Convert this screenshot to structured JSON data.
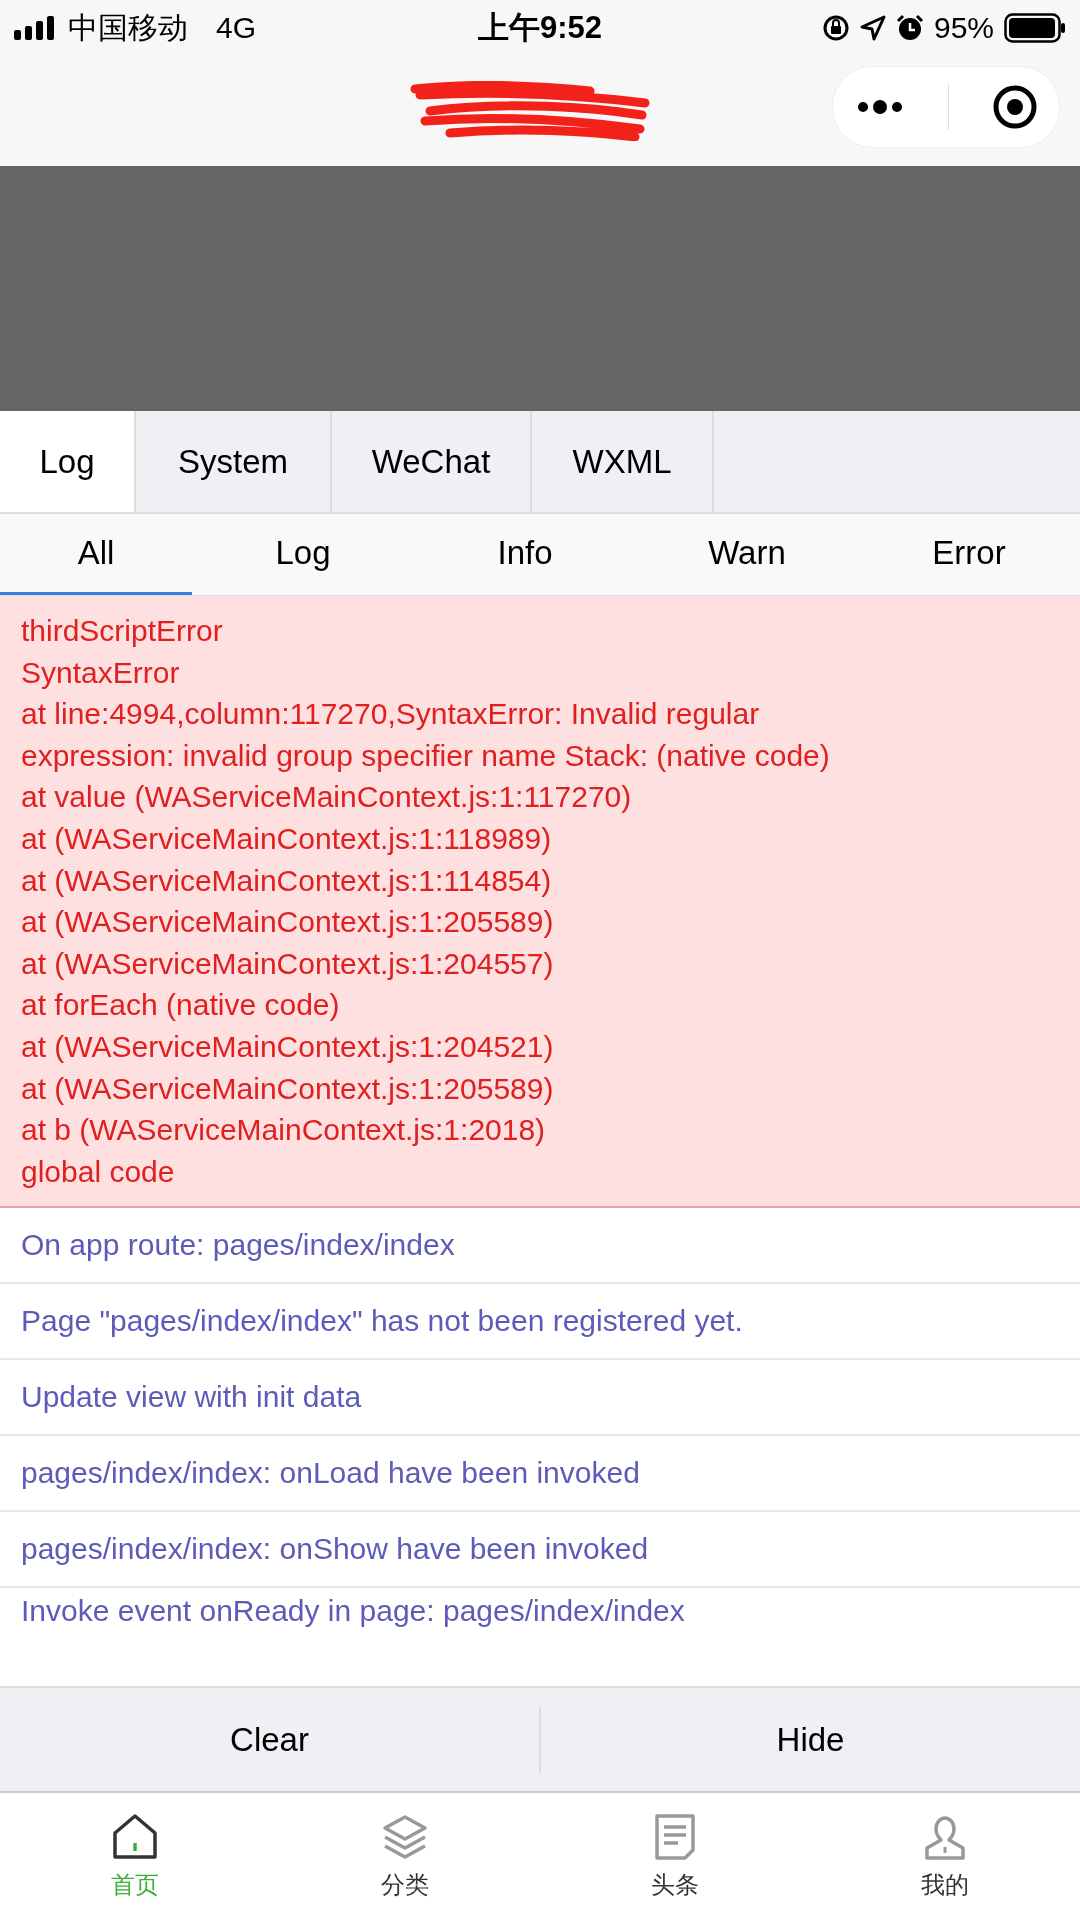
{
  "status_bar": {
    "carrier": "中国移动",
    "network": "4G",
    "time": "上午9:52",
    "battery": "95%"
  },
  "tabs": [
    {
      "label": "Log",
      "selected": true
    },
    {
      "label": "System",
      "selected": false
    },
    {
      "label": "WeChat",
      "selected": false
    },
    {
      "label": "WXML",
      "selected": false
    }
  ],
  "filters": [
    {
      "label": "All",
      "selected": true
    },
    {
      "label": "Log",
      "selected": false
    },
    {
      "label": "Info",
      "selected": false
    },
    {
      "label": "Warn",
      "selected": false
    },
    {
      "label": "Error",
      "selected": false
    }
  ],
  "entries": [
    {
      "kind": "error",
      "lines": [
        "thirdScriptError",
        "SyntaxError",
        "at line:4994,column:117270,SyntaxError: Invalid regular expression: invalid group specifier name Stack: (native code)",
        "at value (WAServiceMainContext.js:1:117270)",
        "at (WAServiceMainContext.js:1:118989)",
        "at (WAServiceMainContext.js:1:114854)",
        "at (WAServiceMainContext.js:1:205589)",
        "at (WAServiceMainContext.js:1:204557)",
        "at forEach (native code)",
        "at (WAServiceMainContext.js:1:204521)",
        "at (WAServiceMainContext.js:1:205589)",
        "at b (WAServiceMainContext.js:1:2018)",
        "global code"
      ]
    },
    {
      "kind": "log",
      "lines": [
        "On app route: pages/index/index"
      ]
    },
    {
      "kind": "log",
      "lines": [
        "Page \"pages/index/index\" has not been registered yet."
      ]
    },
    {
      "kind": "log",
      "lines": [
        "Update view with init data"
      ]
    },
    {
      "kind": "log",
      "lines": [
        "pages/index/index: onLoad have been invoked"
      ]
    },
    {
      "kind": "log",
      "lines": [
        "pages/index/index: onShow have been invoked"
      ]
    },
    {
      "kind": "log",
      "lines": [
        "Invoke event onReady in page: pages/index/index"
      ]
    }
  ],
  "actions": [
    "Clear",
    "Hide"
  ],
  "tab_bar": [
    {
      "label": "首页",
      "kind": "home",
      "selected": true
    },
    {
      "label": "分类",
      "kind": "layers",
      "selected": false
    },
    {
      "label": "头条",
      "kind": "document",
      "selected": false
    },
    {
      "label": "我的",
      "kind": "person",
      "selected": false
    }
  ]
}
